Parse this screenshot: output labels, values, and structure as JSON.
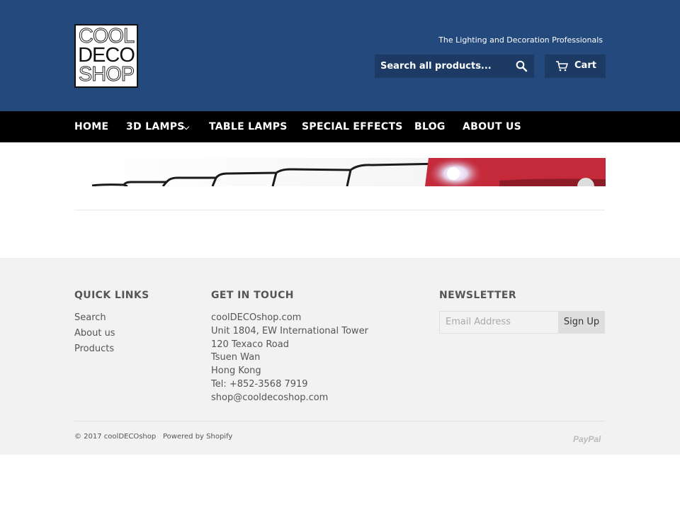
{
  "header": {
    "logo_lines": [
      "COOL",
      "DECO",
      "SHOP"
    ],
    "tagline": "The Lighting and Decoration Professionals",
    "search_placeholder": "Search all products...",
    "cart_label": "Cart"
  },
  "nav": {
    "items": [
      {
        "label": "HOME"
      },
      {
        "label": "3D LAMPS",
        "has_dropdown": true
      },
      {
        "label": "TABLE LAMPS"
      },
      {
        "label": "SPECIAL EFFECTS"
      },
      {
        "label": "BLOG"
      },
      {
        "label": "ABOUT US"
      }
    ]
  },
  "footer": {
    "quick_links": {
      "heading": "QUICK LINKS",
      "links": [
        "Search",
        "About us",
        "Products"
      ]
    },
    "contact": {
      "heading": "GET IN TOUCH",
      "lines": [
        "coolDECOshop.com",
        "Unit 1804, EW International Tower",
        "120 Texaco Road",
        "Tsuen Wan",
        "Hong Kong",
        "Tel: +852-3568 7919",
        "shop@cooldecoshop.com"
      ]
    },
    "newsletter": {
      "heading": "NEWSLETTER",
      "email_placeholder": "Email Address",
      "button_label": "Sign Up"
    },
    "copyright": "© 2017 coolDECOshop",
    "powered_by": "Powered by Shopify",
    "payment_icon": "PayPal"
  },
  "colors": {
    "header_bg": "#24497c",
    "header_control_bg": "#1c3a64",
    "nav_bg": "#000000",
    "footer_bg": "#f2f2f2"
  }
}
